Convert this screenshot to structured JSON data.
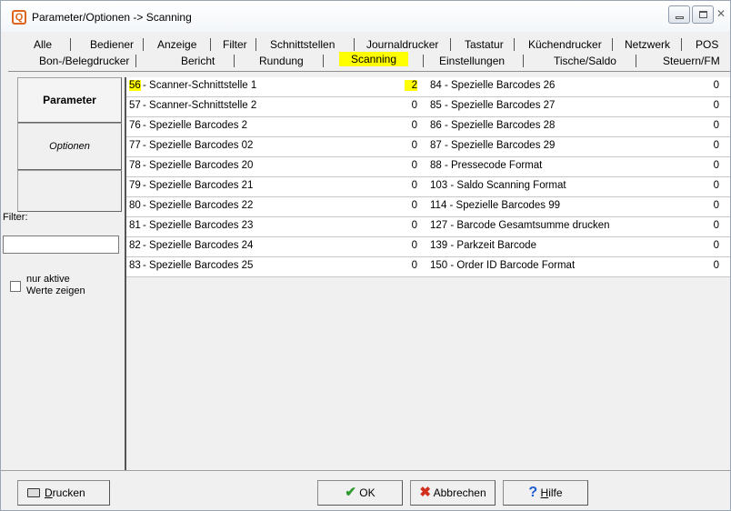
{
  "window": {
    "title": "Parameter/Optionen -> Scanning",
    "icon_letter": "Q",
    "controls": [
      "minimize-icon",
      "maximize-icon",
      "close-icon"
    ],
    "close_glyph": "✕"
  },
  "tabs_row1": [
    "Alle",
    "Bediener",
    "Anzeige",
    "Filter",
    "Schnittstellen",
    "Journaldrucker",
    "Tastatur",
    "Küchendrucker",
    "Netzwerk",
    "POS"
  ],
  "tabs_row2": [
    "Bon-/Belegdrucker",
    "Bericht",
    "Rundung",
    "Scanning",
    "Einstellungen",
    "Tische/Saldo",
    "Steuern/FM"
  ],
  "selected_tab": "Scanning",
  "sidebar": {
    "parameter_label": "Parameter",
    "optionen_label": "Optionen",
    "filter_label": "Filter:",
    "filter_value": "",
    "checkbox_label_line1": "nur aktive",
    "checkbox_label_line2": "Werte zeigen"
  },
  "rows": [
    {
      "left_id": "56",
      "left_name": " - Scanner-Schnittstelle 1",
      "left_value": "2",
      "right_label": "84 - Spezielle Barcodes 26",
      "right_value": "0"
    },
    {
      "left_id": "57",
      "left_name": " - Scanner-Schnittstelle 2",
      "left_value": "0",
      "right_label": "85 - Spezielle Barcodes 27",
      "right_value": "0"
    },
    {
      "left_id": "76",
      "left_name": " - Spezielle Barcodes 2",
      "left_value": "0",
      "right_label": "86 - Spezielle Barcodes 28",
      "right_value": "0"
    },
    {
      "left_id": "77",
      "left_name": " - Spezielle Barcodes 02",
      "left_value": "0",
      "right_label": "87 - Spezielle Barcodes 29",
      "right_value": "0"
    },
    {
      "left_id": "78",
      "left_name": " - Spezielle Barcodes 20",
      "left_value": "0",
      "right_label": "88 - Pressecode Format",
      "right_value": "0"
    },
    {
      "left_id": "79",
      "left_name": " - Spezielle Barcodes 21",
      "left_value": "0",
      "right_label": "103 - Saldo Scanning Format",
      "right_value": "0"
    },
    {
      "left_id": "80",
      "left_name": " - Spezielle Barcodes 22",
      "left_value": "0",
      "right_label": "114 - Spezielle Barcodes 99",
      "right_value": "0"
    },
    {
      "left_id": "81",
      "left_name": " - Spezielle Barcodes 23",
      "left_value": "0",
      "right_label": "127 - Barcode Gesamtsumme drucken",
      "right_value": "0"
    },
    {
      "left_id": "82",
      "left_name": " - Spezielle Barcodes 24",
      "left_value": "0",
      "right_label": "139 - Parkzeit Barcode",
      "right_value": "0"
    },
    {
      "left_id": "83",
      "left_name": " - Spezielle Barcodes 25",
      "left_value": "0",
      "right_label": "150 - Order ID Barcode Format",
      "right_value": "0"
    }
  ],
  "buttons": {
    "drucken_pre": "",
    "drucken_u": "D",
    "drucken_post": "rucken",
    "ok": "OK",
    "abbrechen": "Abbrechen",
    "hilfe_u": "H",
    "hilfe_post": "ilfe"
  },
  "colors": {
    "highlight": "#ffff00",
    "ok_check": "#2e9a2e",
    "cancel_x": "#d32f1e",
    "help_q": "#1e5fcf",
    "app_icon": "#e0651c"
  }
}
